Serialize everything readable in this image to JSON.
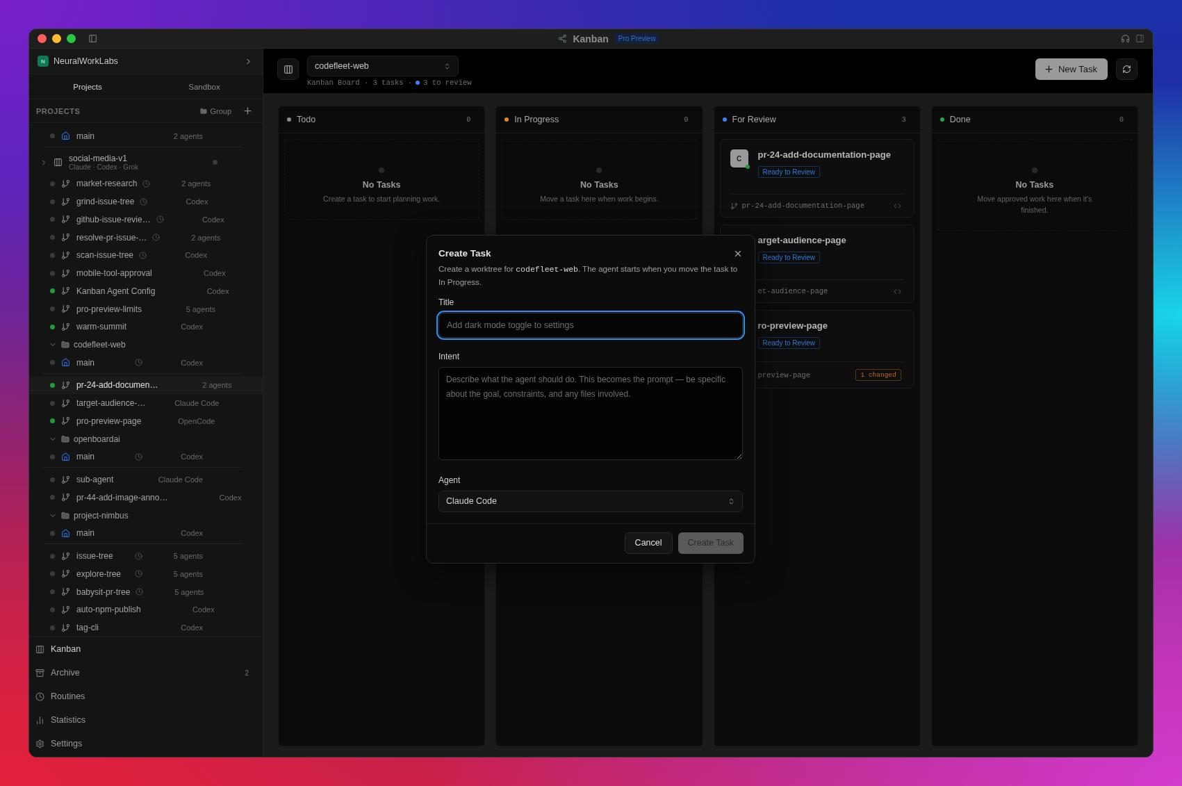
{
  "titlebar": {
    "app": "Kanban",
    "badge": "Pro Preview"
  },
  "sidebar": {
    "workspace": {
      "initial": "N",
      "name": "NeuralWorkLabs"
    },
    "tabs": [
      {
        "label": "Projects",
        "selected": true
      },
      {
        "label": "Sandbox",
        "selected": false
      }
    ],
    "section": {
      "title": "PROJECTS",
      "group": "Group"
    },
    "items": [
      {
        "kind": "home",
        "name": "main",
        "agent": "2 agents",
        "active": false,
        "scheduled": false,
        "selected": false
      },
      {
        "kind": "project",
        "name": "social-media-v1",
        "subtitle": "Claude · Codex · Grok",
        "expanded": false
      },
      {
        "kind": "branch",
        "name": "market-research",
        "agent": "2 agents",
        "active": false,
        "scheduled": true,
        "selected": false
      },
      {
        "kind": "branch",
        "name": "grind-issue-tree",
        "agent": "Codex",
        "active": false,
        "scheduled": true,
        "selected": false
      },
      {
        "kind": "branch",
        "name": "github-issue-revie…",
        "agent": "Codex",
        "active": false,
        "scheduled": true,
        "selected": false
      },
      {
        "kind": "branch",
        "name": "resolve-pr-issue-…",
        "agent": "2 agents",
        "active": false,
        "scheduled": true,
        "selected": false
      },
      {
        "kind": "branch",
        "name": "scan-issue-tree",
        "agent": "Codex",
        "active": false,
        "scheduled": true,
        "selected": false
      },
      {
        "kind": "branch",
        "name": "mobile-tool-approval",
        "agent": "Codex",
        "active": false,
        "scheduled": false,
        "selected": false
      },
      {
        "kind": "branch",
        "name": "Kanban Agent Config",
        "agent": "Codex",
        "active": true,
        "scheduled": false,
        "selected": false
      },
      {
        "kind": "branch",
        "name": "pro-preview-limits",
        "agent": "5 agents",
        "active": false,
        "scheduled": false,
        "selected": false
      },
      {
        "kind": "branch",
        "name": "warm-summit",
        "agent": "Codex",
        "active": true,
        "scheduled": false,
        "selected": false
      },
      {
        "kind": "folder",
        "name": "codefleet-web",
        "expanded": true,
        "children": [
          {
            "kind": "home",
            "name": "main",
            "agent": "Codex",
            "active": false,
            "scheduled": true,
            "selected": false
          },
          {
            "kind": "branch",
            "name": "pr-24-add-documen…",
            "agent": "2 agents",
            "active": true,
            "scheduled": false,
            "selected": true
          },
          {
            "kind": "branch",
            "name": "target-audience-…",
            "agent": "Claude Code",
            "active": false,
            "scheduled": false,
            "selected": false
          },
          {
            "kind": "branch",
            "name": "pro-preview-page",
            "agent": "OpenCode",
            "active": true,
            "scheduled": false,
            "selected": false
          }
        ]
      },
      {
        "kind": "folder",
        "name": "openboardai",
        "expanded": true,
        "children": [
          {
            "kind": "home",
            "name": "main",
            "agent": "Codex",
            "active": false,
            "scheduled": true,
            "selected": false
          },
          {
            "kind": "branch",
            "name": "sub-agent",
            "agent": "Claude Code",
            "active": false,
            "scheduled": false,
            "selected": false
          },
          {
            "kind": "branch",
            "name": "pr-44-add-image-anno…",
            "agent": "Codex",
            "active": false,
            "scheduled": false,
            "selected": false
          }
        ]
      },
      {
        "kind": "folder",
        "name": "project-nimbus",
        "expanded": true,
        "children": [
          {
            "kind": "home",
            "name": "main",
            "agent": "Codex",
            "active": false,
            "scheduled": false,
            "selected": false
          },
          {
            "kind": "branch",
            "name": "issue-tree",
            "agent": "5 agents",
            "active": false,
            "scheduled": true,
            "selected": false
          },
          {
            "kind": "branch",
            "name": "explore-tree",
            "agent": "5 agents",
            "active": false,
            "scheduled": true,
            "selected": false
          },
          {
            "kind": "branch",
            "name": "babysit-pr-tree",
            "agent": "5 agents",
            "active": false,
            "scheduled": true,
            "selected": false
          },
          {
            "kind": "branch",
            "name": "auto-npm-publish",
            "agent": "Codex",
            "active": false,
            "scheduled": false,
            "selected": false
          },
          {
            "kind": "branch",
            "name": "tag-cli",
            "agent": "Codex",
            "active": false,
            "scheduled": false,
            "selected": false
          }
        ]
      }
    ],
    "nav": [
      {
        "kind": "kanban",
        "label": "Kanban",
        "selected": true
      },
      {
        "kind": "archive",
        "label": "Archive",
        "count": "2",
        "selected": false
      },
      {
        "kind": "routines",
        "label": "Routines",
        "selected": false
      },
      {
        "kind": "statistics",
        "label": "Statistics",
        "selected": false
      },
      {
        "kind": "settings",
        "label": "Settings",
        "selected": false
      }
    ]
  },
  "header": {
    "project": "codefleet-web",
    "subtitle": "Kanban Board · 3 tasks ·",
    "review": "3 to review",
    "new_task": "New Task"
  },
  "columns": [
    {
      "title": "Todo",
      "count": "0",
      "color": "#8a8a8a",
      "empty_title": "No Tasks",
      "empty_hint": "Create a task to start planning work."
    },
    {
      "title": "In Progress",
      "count": "0",
      "color": "#e08a1e",
      "empty_title": "No Tasks",
      "empty_hint": "Move a task here when work begins."
    },
    {
      "title": "For Review",
      "count": "3",
      "color": "#3b82f6",
      "cards": [
        {
          "kind": "full",
          "avatar": "C",
          "title": "pr-24-add-documentation-page",
          "status": "Ready to Review",
          "branch": "pr-24-add-documentation-page"
        },
        {
          "kind": "covered",
          "title": "arget-audience-page",
          "status": "Ready to Review",
          "branch": "et-audience-page"
        },
        {
          "kind": "covered",
          "title": "ro-preview-page",
          "status": "Ready to Review",
          "branch": "preview-page",
          "changed": "1 changed"
        }
      ]
    },
    {
      "title": "Done",
      "count": "0",
      "color": "#22a845",
      "empty_title": "No Tasks",
      "empty_hint": "Move approved work here when it's finished."
    }
  ],
  "dialog": {
    "title": "Create Task",
    "description": {
      "before": "Create a worktree for ",
      "code": "codefleet-web",
      "after": ". The agent starts when you move the task to In Progress."
    },
    "title_label": "Title",
    "title_placeholder": "Add dark mode toggle to settings",
    "intent_label": "Intent",
    "intent_placeholder": "Describe what the agent should do. This becomes the prompt — be specific about the goal, constraints, and any files involved.",
    "agent_label": "Agent",
    "agent_value": "Claude Code",
    "cancel": "Cancel",
    "create": {
      "label": "Create Task",
      "disabled": true
    }
  }
}
